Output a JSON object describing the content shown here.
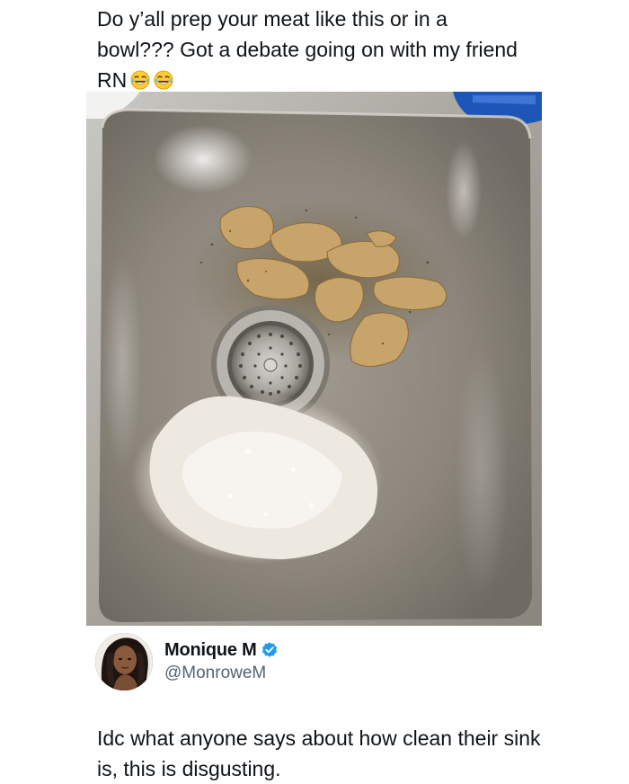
{
  "quoted_post": {
    "text": "Do y’all prep your meat like this or in a bowl??? Got a debate going on with my friend RN",
    "emojis": [
      "face-with-tears-of-joy-icon",
      "face-with-tears-of-joy-icon"
    ]
  },
  "photo": {
    "subject": "stainless-sink-with-seasoned-chicken-and-flour"
  },
  "author": {
    "display_name": "Monique M",
    "handle": "@MonroweM",
    "verified": true,
    "verified_color": "#1d9bf0"
  },
  "reply": {
    "text": "Idc what anyone says about how clean their sink is, this is disgusting."
  },
  "colors": {
    "text_primary": "#0f1419",
    "text_secondary": "#536471",
    "background": "#ffffff"
  }
}
